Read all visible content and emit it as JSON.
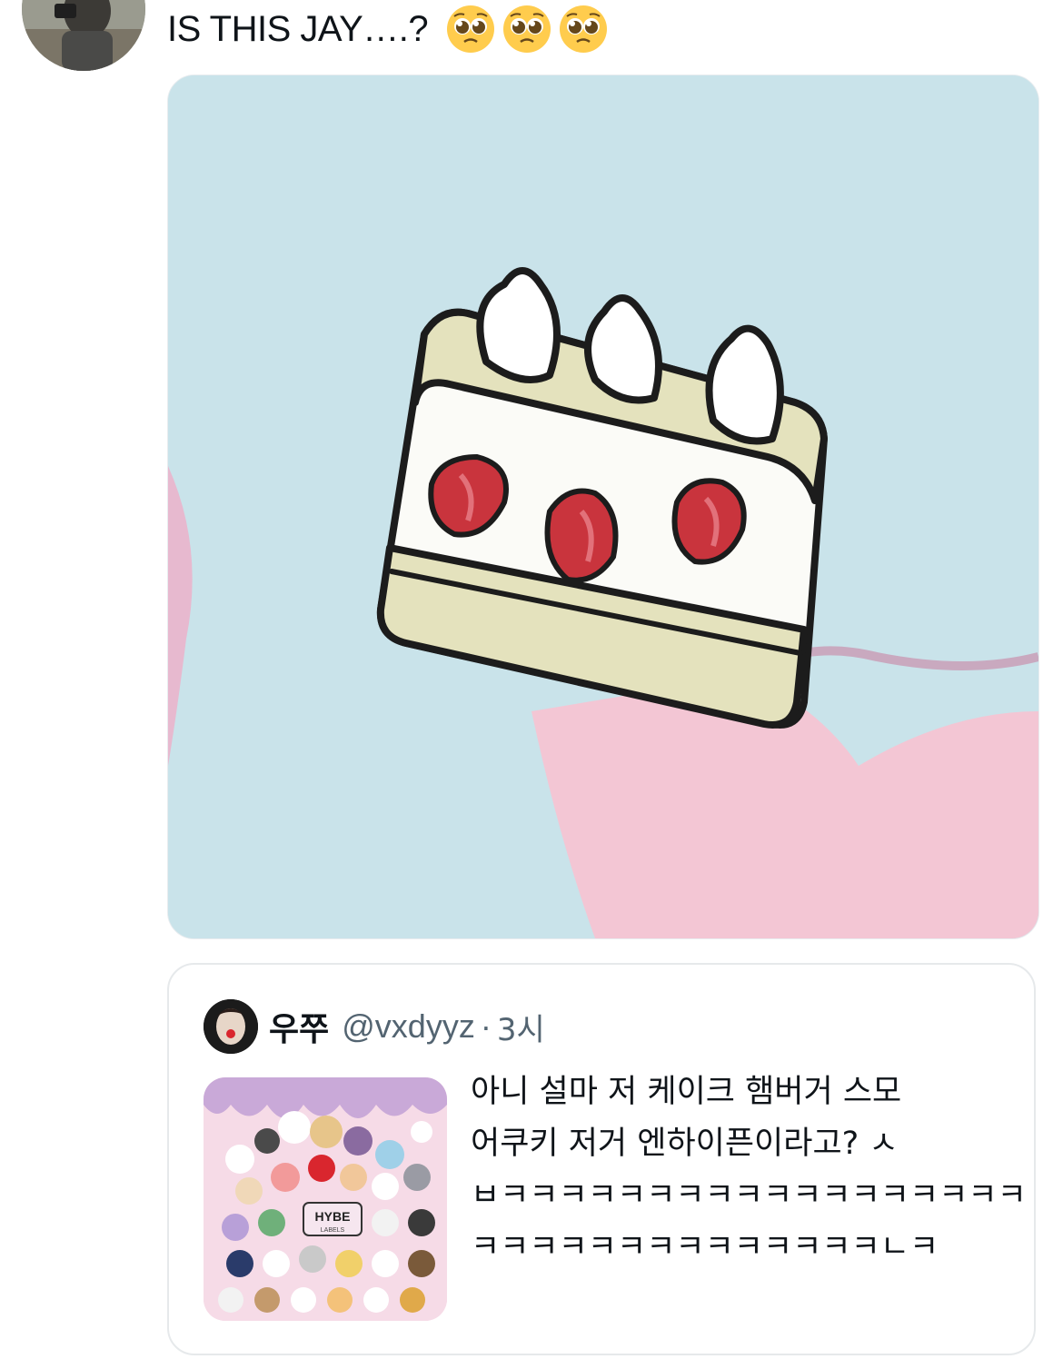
{
  "tweet": {
    "avatar_icon": "user-avatar-photo-icon",
    "text": "IS THIS JAY….?",
    "emojis": [
      "pleading-face-icon",
      "pleading-face-icon",
      "pleading-face-icon"
    ]
  },
  "media": {
    "icon": "strawberry-shortcake-illustration",
    "background_color": "#c8e2e8",
    "accent_color": "#f2c6d3"
  },
  "quote": {
    "avatar_icon": "quoted-user-avatar-icon",
    "name": "우쭈",
    "handle": "@vxdyyz",
    "separator": "·",
    "time": "3시",
    "thumbnail_icon": "hybe-labels-characters-thumbnail",
    "thumbnail_label": "HYBE",
    "thumbnail_sublabel": "LABELS",
    "body_lines": [
      "아니 설마 저 케이크 햄버거 스모",
      "어쿠키 저거 엔하이픈이라고? ㅅ",
      "ㅂㅋㅋㅋㅋㅋㅋㅋㅋㅋㅋㅋㅋㅋㅋㅋㅋㅋㅋ",
      "ㅋㅋㅋㅋㅋㅋㅋㅋㅋㅋㅋㅋㅋㅋㄴㅋ"
    ]
  }
}
